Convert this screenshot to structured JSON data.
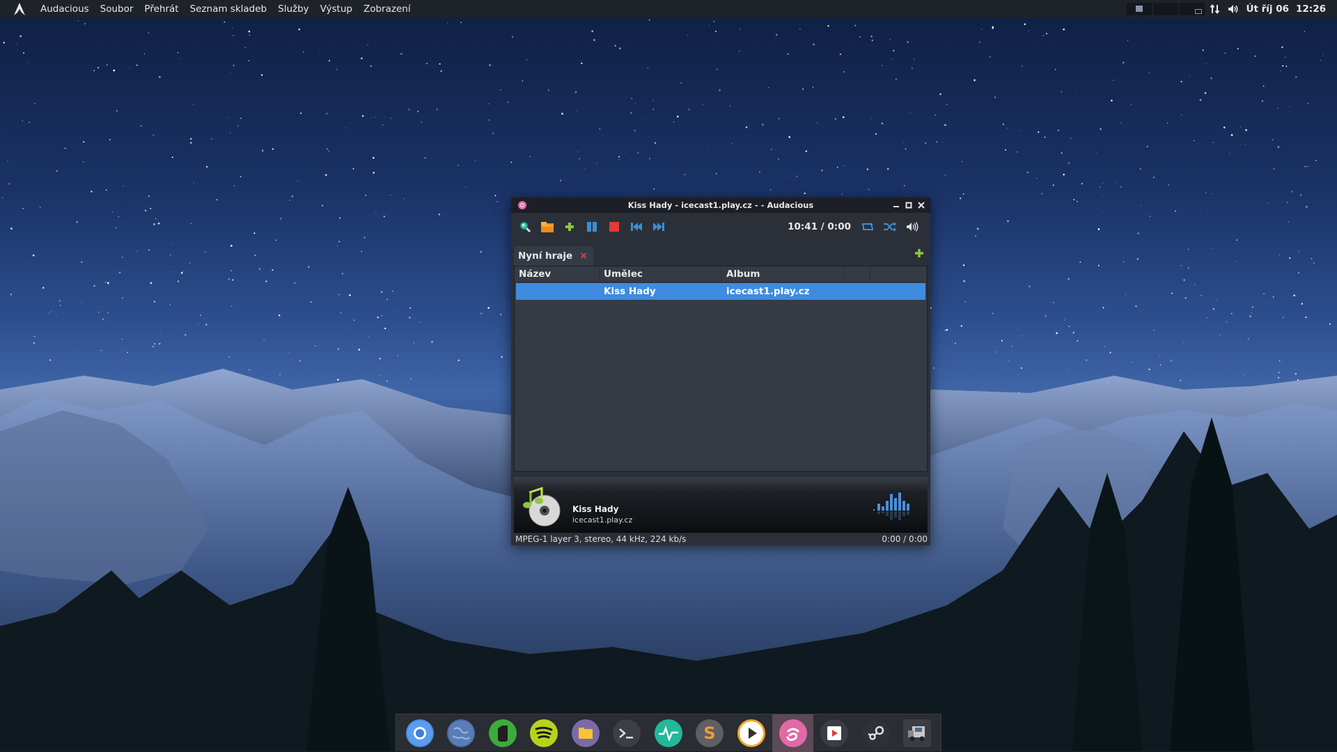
{
  "top_panel": {
    "menu": [
      "Audacious",
      "Soubor",
      "Přehrát",
      "Seznam skladeb",
      "Služby",
      "Výstup",
      "Zobrazení"
    ],
    "date": "Út říj 06",
    "time": "12:26",
    "tray_icons": [
      "network-icon",
      "volume-icon"
    ]
  },
  "window": {
    "title": "Kiss Hady - icecast1.play.cz -  - Audacious",
    "toolbar": {
      "buttons": [
        "search-icon",
        "open-icon",
        "add-icon",
        "pause-icon",
        "stop-icon",
        "previous-icon",
        "next-icon"
      ],
      "time": "10:41 / 0:00",
      "right_buttons": [
        "repeat-icon",
        "shuffle-icon",
        "volume-icon"
      ]
    },
    "tab": {
      "label": "Nyní hraje"
    },
    "playlist": {
      "columns": [
        "Název",
        "Umělec",
        "Album",
        "",
        ""
      ],
      "rows": [
        {
          "title": "",
          "artist": "Kiss Hady",
          "album": "icecast1.play.cz",
          "selected": true
        }
      ]
    },
    "info": {
      "title": "Kiss Hady",
      "subtitle": "icecast1.play.cz"
    },
    "status": {
      "format": "MPEG-1 layer 3, stereo, 44 kHz, 224 kb/s",
      "time": "0:00 / 0:00"
    }
  },
  "dock": {
    "items": [
      "chromium",
      "globe",
      "evernote",
      "spotify",
      "files",
      "terminal",
      "system-monitor",
      "sublime-text",
      "media-player",
      "audacious",
      "youtube",
      "steam",
      "truck-simulator"
    ],
    "active": "audacious"
  },
  "colors": {
    "accent": "#3f8be0",
    "panel": "#1e2229",
    "window_bg": "#2b3038",
    "toolbar_green": "#8ec63f",
    "toolbar_blue": "#3a8fd6",
    "toolbar_red": "#e03a3a",
    "toolbar_orange": "#f08a1c"
  }
}
